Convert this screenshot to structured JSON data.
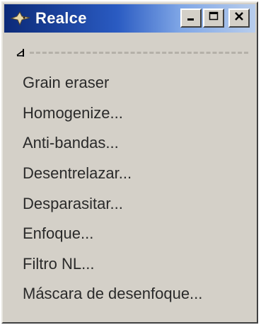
{
  "window": {
    "title": "Realce",
    "title_icon": "wilber-icon",
    "buttons": {
      "minimize": "minimize-icon",
      "maximize": "maximize-icon",
      "close": "close-icon"
    }
  },
  "menu": {
    "items": [
      {
        "label": "Grain eraser"
      },
      {
        "label": "Homogenize..."
      },
      {
        "label": "Anti-bandas..."
      },
      {
        "label": "Desentrelazar..."
      },
      {
        "label": "Desparasitar..."
      },
      {
        "label": "Enfoque..."
      },
      {
        "label": "Filtro NL..."
      },
      {
        "label": "Máscara de desenfoque..."
      }
    ]
  },
  "colors": {
    "titlebar_start": "#0c2a78",
    "titlebar_end": "#b8cdec",
    "face": "#d4d0c8",
    "text": "#2a2a2a"
  }
}
